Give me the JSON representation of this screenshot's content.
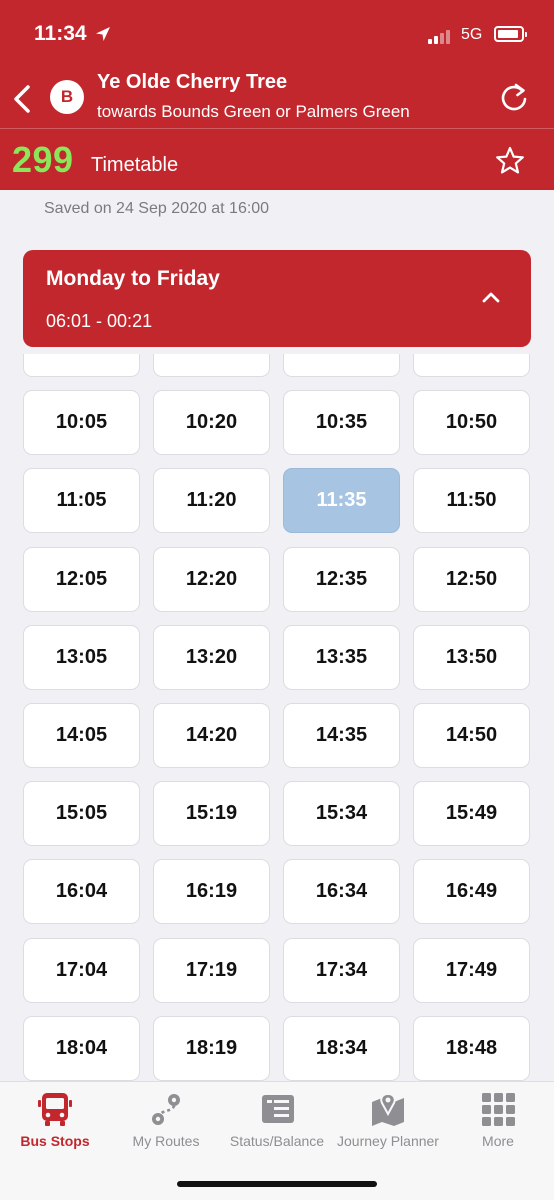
{
  "status_bar": {
    "time": "11:34",
    "carrier": "5G"
  },
  "header": {
    "stop_letter": "B",
    "stop_name": "Ye Olde Cherry Tree",
    "direction": "towards Bounds Green or Palmers Green",
    "route_number": "299",
    "route_label": "Timetable"
  },
  "saved_text": "Saved on 24 Sep 2020 at 16:00",
  "day_panel": {
    "title": "Monday to Friday",
    "range": "06:01 - 00:21"
  },
  "timetable": {
    "rows": [
      [
        "",
        "",
        "",
        ""
      ],
      [
        "10:05",
        "10:20",
        "10:35",
        "10:50"
      ],
      [
        "11:05",
        "11:20",
        "11:35",
        "11:50"
      ],
      [
        "12:05",
        "12:20",
        "12:35",
        "12:50"
      ],
      [
        "13:05",
        "13:20",
        "13:35",
        "13:50"
      ],
      [
        "14:05",
        "14:20",
        "14:35",
        "14:50"
      ],
      [
        "15:05",
        "15:19",
        "15:34",
        "15:49"
      ],
      [
        "16:04",
        "16:19",
        "16:34",
        "16:49"
      ],
      [
        "17:04",
        "17:19",
        "17:34",
        "17:49"
      ],
      [
        "18:04",
        "18:19",
        "18:34",
        "18:48"
      ]
    ],
    "highlighted": "11:35"
  },
  "tabs": [
    {
      "label": "Bus Stops",
      "icon": "bus-icon",
      "active": true
    },
    {
      "label": "My Routes",
      "icon": "route-icon",
      "active": false
    },
    {
      "label": "Status/Balance",
      "icon": "card-list-icon",
      "active": false
    },
    {
      "label": "Journey Planner",
      "icon": "map-pin-icon",
      "active": false
    },
    {
      "label": "More",
      "icon": "grid-icon",
      "active": false
    }
  ],
  "colors": {
    "brand_red": "#c1272d",
    "route_green": "#8de65a",
    "highlight_blue": "#a7c4e2"
  }
}
